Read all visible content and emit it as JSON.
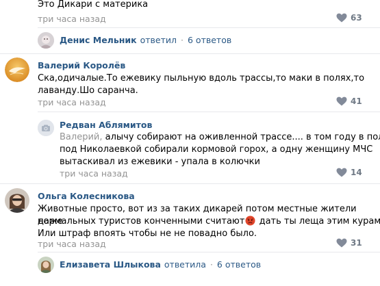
{
  "comments": [
    {
      "text": "Это Дикари с материка",
      "time": "три часа назад",
      "likes": "63"
    },
    {
      "author": "Валерий Королёв",
      "text_lines": [
        "Ска,одичалые.То ежевику пыльную вдоль трассы,то маки в полях,то",
        "лаванду.Шо саранча."
      ],
      "time": "три часа назад",
      "likes": "41"
    },
    {
      "author": "Редван Аблямитов",
      "mention": "Валерий,",
      "text_lines": [
        " алычу собирают на оживленной трассе.... в том году в поле",
        "под Николаевкой собирали кормовой горох, а одну женщину МЧС",
        "вытаскивал из ежевики - упала в колючки"
      ],
      "time": "три часа назад",
      "likes": "14"
    },
    {
      "author": "Ольга Колесникова",
      "text_lines": [
        "Животные просто, вот из за таких дикарей потом местные жители даже",
        "нормальных туристов конченными считают",
        " дать ты леща этим курам!!!",
        "Или штраф впоять чтобы не не повадно было."
      ],
      "time": "три часа назад",
      "likes": "31"
    }
  ],
  "threads": [
    {
      "name": "Денис Мельник",
      "verb": "ответил",
      "dot": "·",
      "count": "6 ответов"
    },
    {
      "name": "Елизавета Шлыкова",
      "verb": "ответила",
      "dot": "·",
      "count": "6 ответов"
    }
  ],
  "colors": {
    "link": "#2a5885",
    "meta": "#939393",
    "divider": "#e7e8ec",
    "like_icon": "#828a99"
  },
  "icons": {
    "like": "heart-icon",
    "camera": "camera-icon",
    "emoji": "angry-face-icon"
  }
}
